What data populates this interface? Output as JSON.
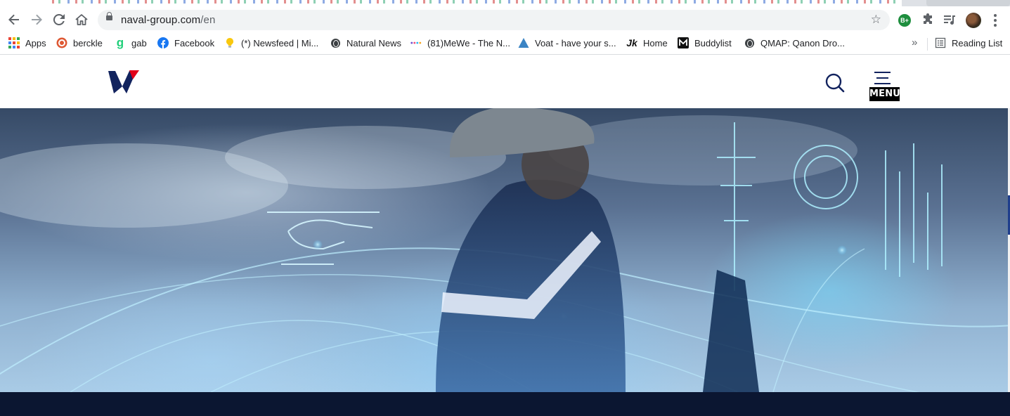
{
  "browser": {
    "url_host": "naval-group.com",
    "url_path": "/en",
    "extension_badge": "B+",
    "colors": {
      "toolbar_bg": "#ffffff",
      "omnibox_bg": "#f1f3f4",
      "icon_gray": "#5f6368"
    }
  },
  "bookmarks": {
    "items": [
      {
        "label": "Apps",
        "icon": "apps-grid-icon"
      },
      {
        "label": "berckle",
        "icon": "berckle-icon"
      },
      {
        "label": "gab",
        "icon": "gab-icon"
      },
      {
        "label": "Facebook",
        "icon": "facebook-icon"
      },
      {
        "label": "(*) Newsfeed | Mi...",
        "icon": "lightbulb-icon"
      },
      {
        "label": "Natural News",
        "icon": "globe-icon"
      },
      {
        "label": "(81)MeWe - The N...",
        "icon": "mewe-icon"
      },
      {
        "label": "Voat - have your s...",
        "icon": "voat-icon"
      },
      {
        "label": "Home",
        "icon": "home-bookmark-icon"
      },
      {
        "label": "Buddylist",
        "icon": "buddylist-icon"
      },
      {
        "label": "QMAP: Qanon Dro...",
        "icon": "globe-icon"
      }
    ],
    "overflow_label": "»",
    "reading_list_label": "Reading List"
  },
  "site": {
    "menu_label": "MENU",
    "colors": {
      "navy": "#12235e",
      "red": "#e2001a",
      "footer_band": "#0b1631"
    }
  }
}
